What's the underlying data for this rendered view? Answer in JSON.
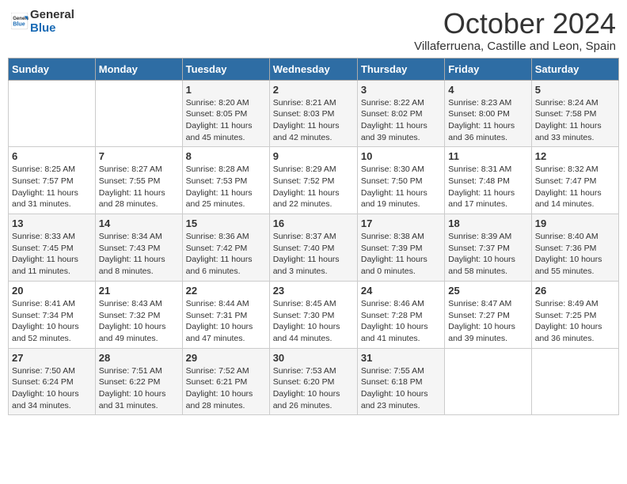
{
  "header": {
    "logo_line1": "General",
    "logo_line2": "Blue",
    "month_title": "October 2024",
    "subtitle": "Villaferruena, Castille and Leon, Spain"
  },
  "days_of_week": [
    "Sunday",
    "Monday",
    "Tuesday",
    "Wednesday",
    "Thursday",
    "Friday",
    "Saturday"
  ],
  "weeks": [
    [
      {
        "num": "",
        "info": ""
      },
      {
        "num": "",
        "info": ""
      },
      {
        "num": "1",
        "info": "Sunrise: 8:20 AM\nSunset: 8:05 PM\nDaylight: 11 hours and 45 minutes."
      },
      {
        "num": "2",
        "info": "Sunrise: 8:21 AM\nSunset: 8:03 PM\nDaylight: 11 hours and 42 minutes."
      },
      {
        "num": "3",
        "info": "Sunrise: 8:22 AM\nSunset: 8:02 PM\nDaylight: 11 hours and 39 minutes."
      },
      {
        "num": "4",
        "info": "Sunrise: 8:23 AM\nSunset: 8:00 PM\nDaylight: 11 hours and 36 minutes."
      },
      {
        "num": "5",
        "info": "Sunrise: 8:24 AM\nSunset: 7:58 PM\nDaylight: 11 hours and 33 minutes."
      }
    ],
    [
      {
        "num": "6",
        "info": "Sunrise: 8:25 AM\nSunset: 7:57 PM\nDaylight: 11 hours and 31 minutes."
      },
      {
        "num": "7",
        "info": "Sunrise: 8:27 AM\nSunset: 7:55 PM\nDaylight: 11 hours and 28 minutes."
      },
      {
        "num": "8",
        "info": "Sunrise: 8:28 AM\nSunset: 7:53 PM\nDaylight: 11 hours and 25 minutes."
      },
      {
        "num": "9",
        "info": "Sunrise: 8:29 AM\nSunset: 7:52 PM\nDaylight: 11 hours and 22 minutes."
      },
      {
        "num": "10",
        "info": "Sunrise: 8:30 AM\nSunset: 7:50 PM\nDaylight: 11 hours and 19 minutes."
      },
      {
        "num": "11",
        "info": "Sunrise: 8:31 AM\nSunset: 7:48 PM\nDaylight: 11 hours and 17 minutes."
      },
      {
        "num": "12",
        "info": "Sunrise: 8:32 AM\nSunset: 7:47 PM\nDaylight: 11 hours and 14 minutes."
      }
    ],
    [
      {
        "num": "13",
        "info": "Sunrise: 8:33 AM\nSunset: 7:45 PM\nDaylight: 11 hours and 11 minutes."
      },
      {
        "num": "14",
        "info": "Sunrise: 8:34 AM\nSunset: 7:43 PM\nDaylight: 11 hours and 8 minutes."
      },
      {
        "num": "15",
        "info": "Sunrise: 8:36 AM\nSunset: 7:42 PM\nDaylight: 11 hours and 6 minutes."
      },
      {
        "num": "16",
        "info": "Sunrise: 8:37 AM\nSunset: 7:40 PM\nDaylight: 11 hours and 3 minutes."
      },
      {
        "num": "17",
        "info": "Sunrise: 8:38 AM\nSunset: 7:39 PM\nDaylight: 11 hours and 0 minutes."
      },
      {
        "num": "18",
        "info": "Sunrise: 8:39 AM\nSunset: 7:37 PM\nDaylight: 10 hours and 58 minutes."
      },
      {
        "num": "19",
        "info": "Sunrise: 8:40 AM\nSunset: 7:36 PM\nDaylight: 10 hours and 55 minutes."
      }
    ],
    [
      {
        "num": "20",
        "info": "Sunrise: 8:41 AM\nSunset: 7:34 PM\nDaylight: 10 hours and 52 minutes."
      },
      {
        "num": "21",
        "info": "Sunrise: 8:43 AM\nSunset: 7:32 PM\nDaylight: 10 hours and 49 minutes."
      },
      {
        "num": "22",
        "info": "Sunrise: 8:44 AM\nSunset: 7:31 PM\nDaylight: 10 hours and 47 minutes."
      },
      {
        "num": "23",
        "info": "Sunrise: 8:45 AM\nSunset: 7:30 PM\nDaylight: 10 hours and 44 minutes."
      },
      {
        "num": "24",
        "info": "Sunrise: 8:46 AM\nSunset: 7:28 PM\nDaylight: 10 hours and 41 minutes."
      },
      {
        "num": "25",
        "info": "Sunrise: 8:47 AM\nSunset: 7:27 PM\nDaylight: 10 hours and 39 minutes."
      },
      {
        "num": "26",
        "info": "Sunrise: 8:49 AM\nSunset: 7:25 PM\nDaylight: 10 hours and 36 minutes."
      }
    ],
    [
      {
        "num": "27",
        "info": "Sunrise: 7:50 AM\nSunset: 6:24 PM\nDaylight: 10 hours and 34 minutes."
      },
      {
        "num": "28",
        "info": "Sunrise: 7:51 AM\nSunset: 6:22 PM\nDaylight: 10 hours and 31 minutes."
      },
      {
        "num": "29",
        "info": "Sunrise: 7:52 AM\nSunset: 6:21 PM\nDaylight: 10 hours and 28 minutes."
      },
      {
        "num": "30",
        "info": "Sunrise: 7:53 AM\nSunset: 6:20 PM\nDaylight: 10 hours and 26 minutes."
      },
      {
        "num": "31",
        "info": "Sunrise: 7:55 AM\nSunset: 6:18 PM\nDaylight: 10 hours and 23 minutes."
      },
      {
        "num": "",
        "info": ""
      },
      {
        "num": "",
        "info": ""
      }
    ]
  ]
}
